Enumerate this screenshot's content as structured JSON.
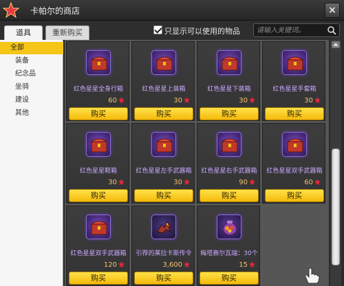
{
  "window": {
    "title": "卡帕尔的商店",
    "close_symbol": "×"
  },
  "toolbar": {
    "tab_items": "道具",
    "tab_rebuy": "重新购买",
    "filter_checked": true,
    "filter_label": "只显示可以使用的物品",
    "search_placeholder": "请输入关键词。"
  },
  "sidebar": {
    "categories": [
      {
        "label": "全部",
        "selected": true
      },
      {
        "label": "装备",
        "selected": false
      },
      {
        "label": "纪念品",
        "selected": false
      },
      {
        "label": "坐骑",
        "selected": false
      },
      {
        "label": "建设",
        "selected": false
      },
      {
        "label": "其他",
        "selected": false
      }
    ]
  },
  "items": [
    {
      "name": "红色星星全身行箱",
      "price": "60",
      "buy_label": "购买",
      "icon": "red-chest-icon"
    },
    {
      "name": "红色星星上装箱",
      "price": "30",
      "buy_label": "购买",
      "icon": "red-chest-icon"
    },
    {
      "name": "红色星星下装箱",
      "price": "30",
      "buy_label": "购买",
      "icon": "red-chest-icon"
    },
    {
      "name": "红色星星手套箱",
      "price": "30",
      "buy_label": "购买",
      "icon": "red-chest-icon"
    },
    {
      "name": "红色星星鞋箱",
      "price": "30",
      "buy_label": "购买",
      "icon": "red-chest-icon"
    },
    {
      "name": "红色星星左手武器箱",
      "price": "30",
      "buy_label": "购买",
      "icon": "red-chest-icon"
    },
    {
      "name": "红色星星右手武器箱",
      "price": "90",
      "buy_label": "购买",
      "icon": "red-chest-icon"
    },
    {
      "name": "红色星星双手武器箱",
      "price": "60",
      "buy_label": "购买",
      "icon": "red-chest-icon"
    },
    {
      "name": "红色星星双手武器箱",
      "price": "120",
      "buy_label": "购买",
      "icon": "red-chest-icon"
    },
    {
      "name": "引荐的莱拉卡斯传令",
      "price": "3,600",
      "buy_label": "购买",
      "icon": "dragon-icon"
    },
    {
      "name": "梅塔赛尔瓦瑞：30个",
      "price": "15",
      "buy_label": "购买",
      "icon": "potion-pouch-icon"
    }
  ],
  "colors": {
    "accent": "#f5c518",
    "item_name": "#c9a9ff",
    "price": "#f2c36b",
    "gem": "#e0283c"
  }
}
